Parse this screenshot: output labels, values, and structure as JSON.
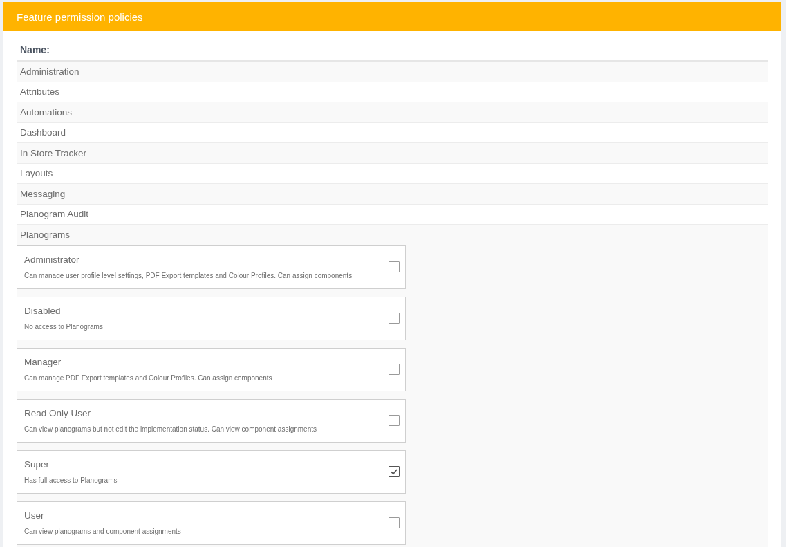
{
  "panel": {
    "title": "Feature permission policies"
  },
  "table": {
    "column_header": "Name:",
    "features": [
      {
        "name": "Administration"
      },
      {
        "name": "Attributes"
      },
      {
        "name": "Automations"
      },
      {
        "name": "Dashboard"
      },
      {
        "name": "In Store Tracker"
      },
      {
        "name": "Layouts"
      },
      {
        "name": "Messaging"
      },
      {
        "name": "Planogram Audit"
      },
      {
        "name": "Planograms",
        "policies": [
          {
            "name": "Administrator",
            "description": "Can manage user profile level settings, PDF Export templates and Colour Profiles. Can assign components",
            "checked": false
          },
          {
            "name": "Disabled",
            "description": "No access to Planograms",
            "checked": false
          },
          {
            "name": "Manager",
            "description": "Can manage PDF Export templates and Colour Profiles. Can assign components",
            "checked": false
          },
          {
            "name": "Read Only User",
            "description": "Can view planograms but not edit the implementation status. Can view component assignments",
            "checked": false
          },
          {
            "name": "Super",
            "description": "Has full access to Planograms",
            "checked": true
          },
          {
            "name": "User",
            "description": "Can view planograms and component assignments",
            "checked": false
          }
        ]
      }
    ]
  }
}
